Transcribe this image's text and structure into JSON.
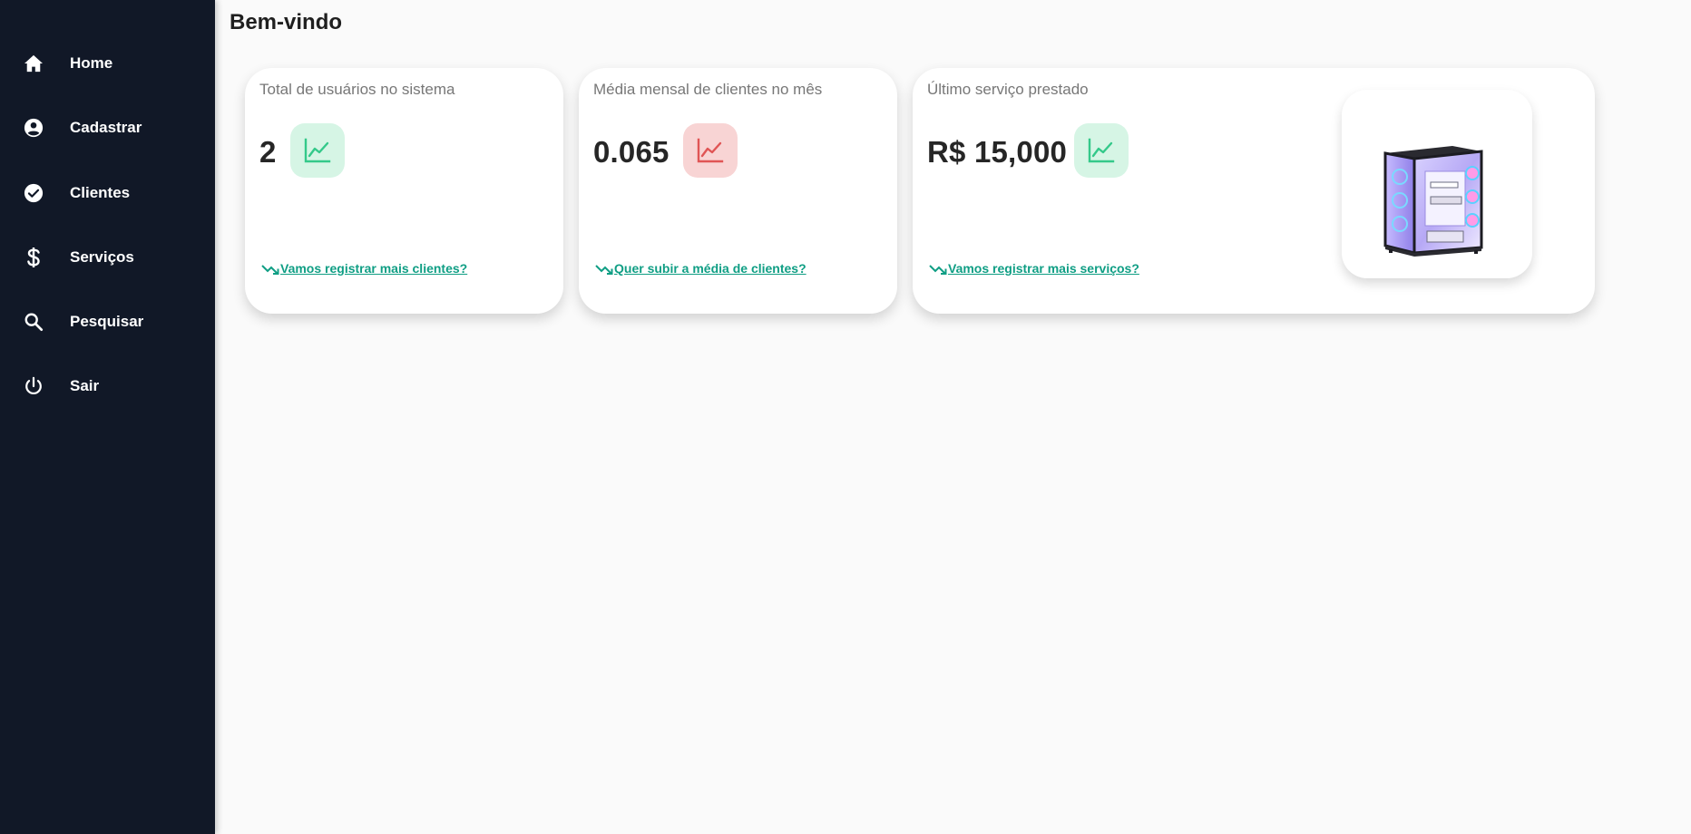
{
  "sidebar": {
    "items": [
      {
        "label": "Home",
        "icon": "home-icon"
      },
      {
        "label": "Cadastrar",
        "icon": "account-circle-icon"
      },
      {
        "label": "Clientes",
        "icon": "check-circle-icon"
      },
      {
        "label": "Serviços",
        "icon": "dollar-icon"
      },
      {
        "label": "Pesquisar",
        "icon": "search-icon"
      },
      {
        "label": "Sair",
        "icon": "power-icon"
      }
    ]
  },
  "main": {
    "title": "Bem-vindo",
    "cards": [
      {
        "label": "Total de usuários no sistema",
        "value": "2",
        "trend_color": "green",
        "link": "Vamos registrar mais clientes?"
      },
      {
        "label": "Média mensal de clientes no mês",
        "value": "0.065",
        "trend_color": "red",
        "link": "Quer subir a média de clientes?"
      },
      {
        "label": "Último serviço prestado",
        "value": "R$ 15,000",
        "trend_color": "green",
        "link": "Vamos registrar mais serviços?",
        "image": "gaming-pc-case"
      }
    ]
  },
  "colors": {
    "sidebar_bg": "#111827",
    "page_bg": "#fafafa",
    "link": "#0f9e84",
    "trend_green": "#34c98a",
    "trend_green_bg": "#d6f5e5",
    "trend_red": "#e05555",
    "trend_red_bg": "#f8d4d4"
  }
}
